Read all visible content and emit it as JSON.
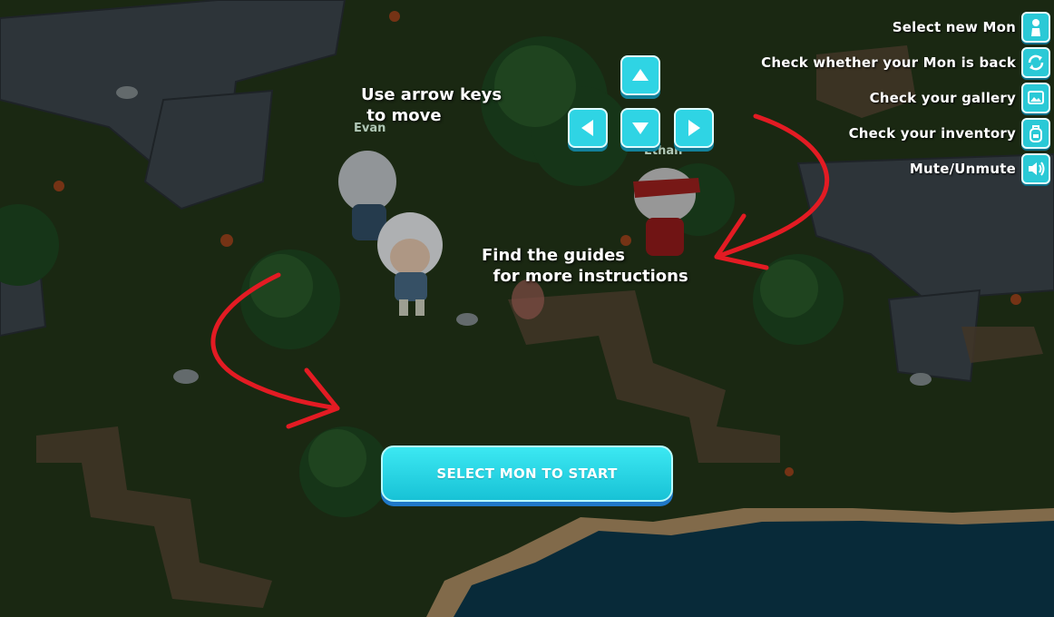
{
  "menu": {
    "items": [
      {
        "label": "Select new Mon",
        "icon": "person-icon"
      },
      {
        "label": "Check whether your Mon is back",
        "icon": "refresh-icon"
      },
      {
        "label": "Check your gallery",
        "icon": "gallery-icon"
      },
      {
        "label": "Check your inventory",
        "icon": "backpack-icon"
      },
      {
        "label": "Mute/Unmute",
        "icon": "speaker-icon"
      }
    ]
  },
  "instructions": {
    "move": "Use arrow keys\n to move",
    "guides": "Find the guides\n  for more instructions"
  },
  "npcs": {
    "left_name": "Evan",
    "right_name": "Ethan"
  },
  "start_button": {
    "label": "SELECT MON TO START"
  },
  "colors": {
    "button": "#2fd4e4",
    "arrow": "#e31b23",
    "water": "#0c3b4f"
  }
}
